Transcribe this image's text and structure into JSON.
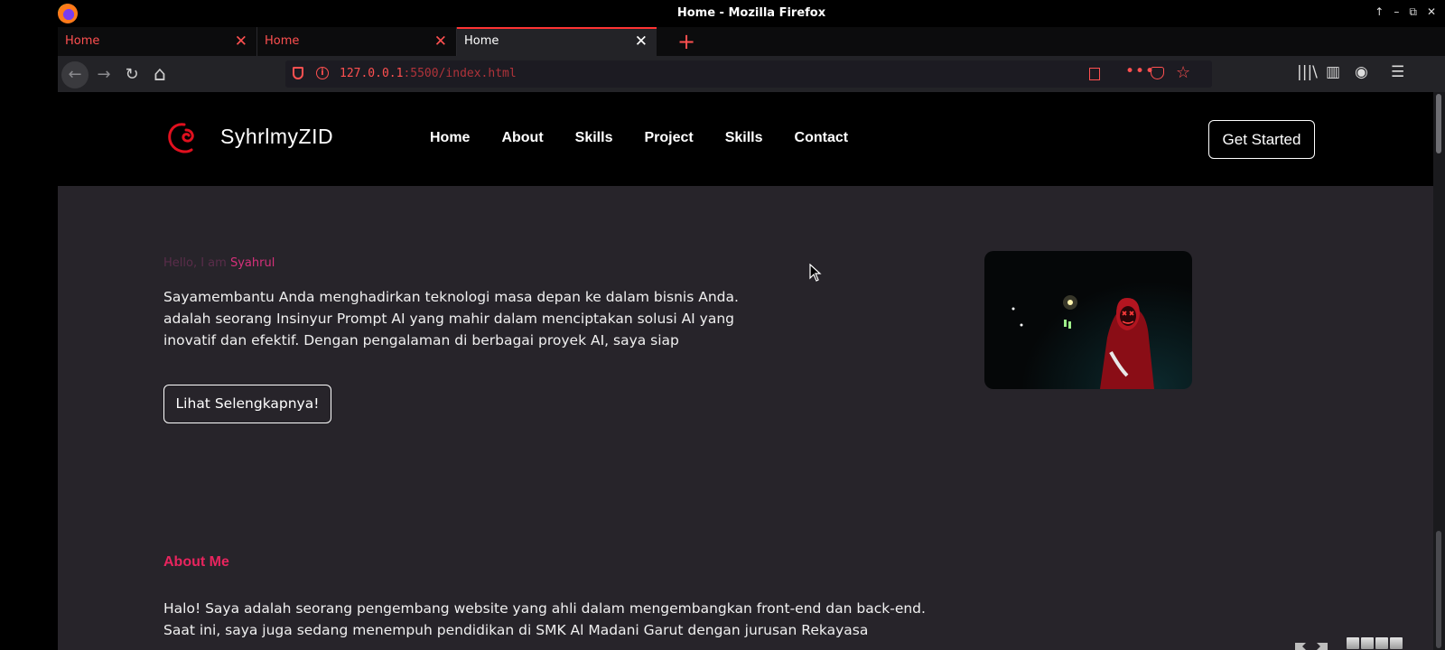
{
  "window": {
    "title": "Home - Mozilla Firefox",
    "controls": [
      "↑",
      "–",
      "⧉",
      "✕"
    ]
  },
  "tabs": [
    {
      "label": "Home",
      "active": false
    },
    {
      "label": "Home",
      "active": false
    },
    {
      "label": "Home",
      "active": true
    }
  ],
  "toolbar": {
    "back_icon": "←",
    "forward_icon": "→",
    "reload_icon": "↻",
    "home_icon": "⌂",
    "new_tab_icon": "+",
    "url_host": "127.0.0.1",
    "url_rest": ":5500/index.html",
    "more_icon": "•••",
    "star_icon": "☆",
    "library_icon": "|||\\",
    "sidebar_icon": "▥",
    "account_icon": "◉",
    "menu_icon": "☰"
  },
  "site": {
    "brand": "SyhrlmyZID",
    "nav": [
      "Home",
      "About",
      "Skills",
      "Project",
      "Skills",
      "Contact"
    ],
    "cta": "Get Started",
    "hero": {
      "greeting": "Hello, I am ",
      "name": "Syahrul",
      "intro": "Sayamembantu Anda menghadirkan teknologi masa depan ke dalam bisnis Anda. adalah seorang Insinyur Prompt AI yang mahir dalam menciptakan solusi AI yang inovatif dan efektif. Dengan pengalaman di berbagai proyek AI, saya siap",
      "button": "Lihat Selengkapnya!"
    },
    "about": {
      "title": "About Me",
      "text": "Halo! Saya adalah seorang pengembang website yang ahli dalam mengembangkan front-end dan back-end. Saat ini, saya juga sedang menempuh pendidikan di SMK Al Madani Garut dengan jurusan Rekayasa"
    }
  },
  "colors": {
    "accent": "#e8245e",
    "browser_accent": "#ff5050",
    "page_bg": "#27242a",
    "header_bg": "#000000"
  }
}
